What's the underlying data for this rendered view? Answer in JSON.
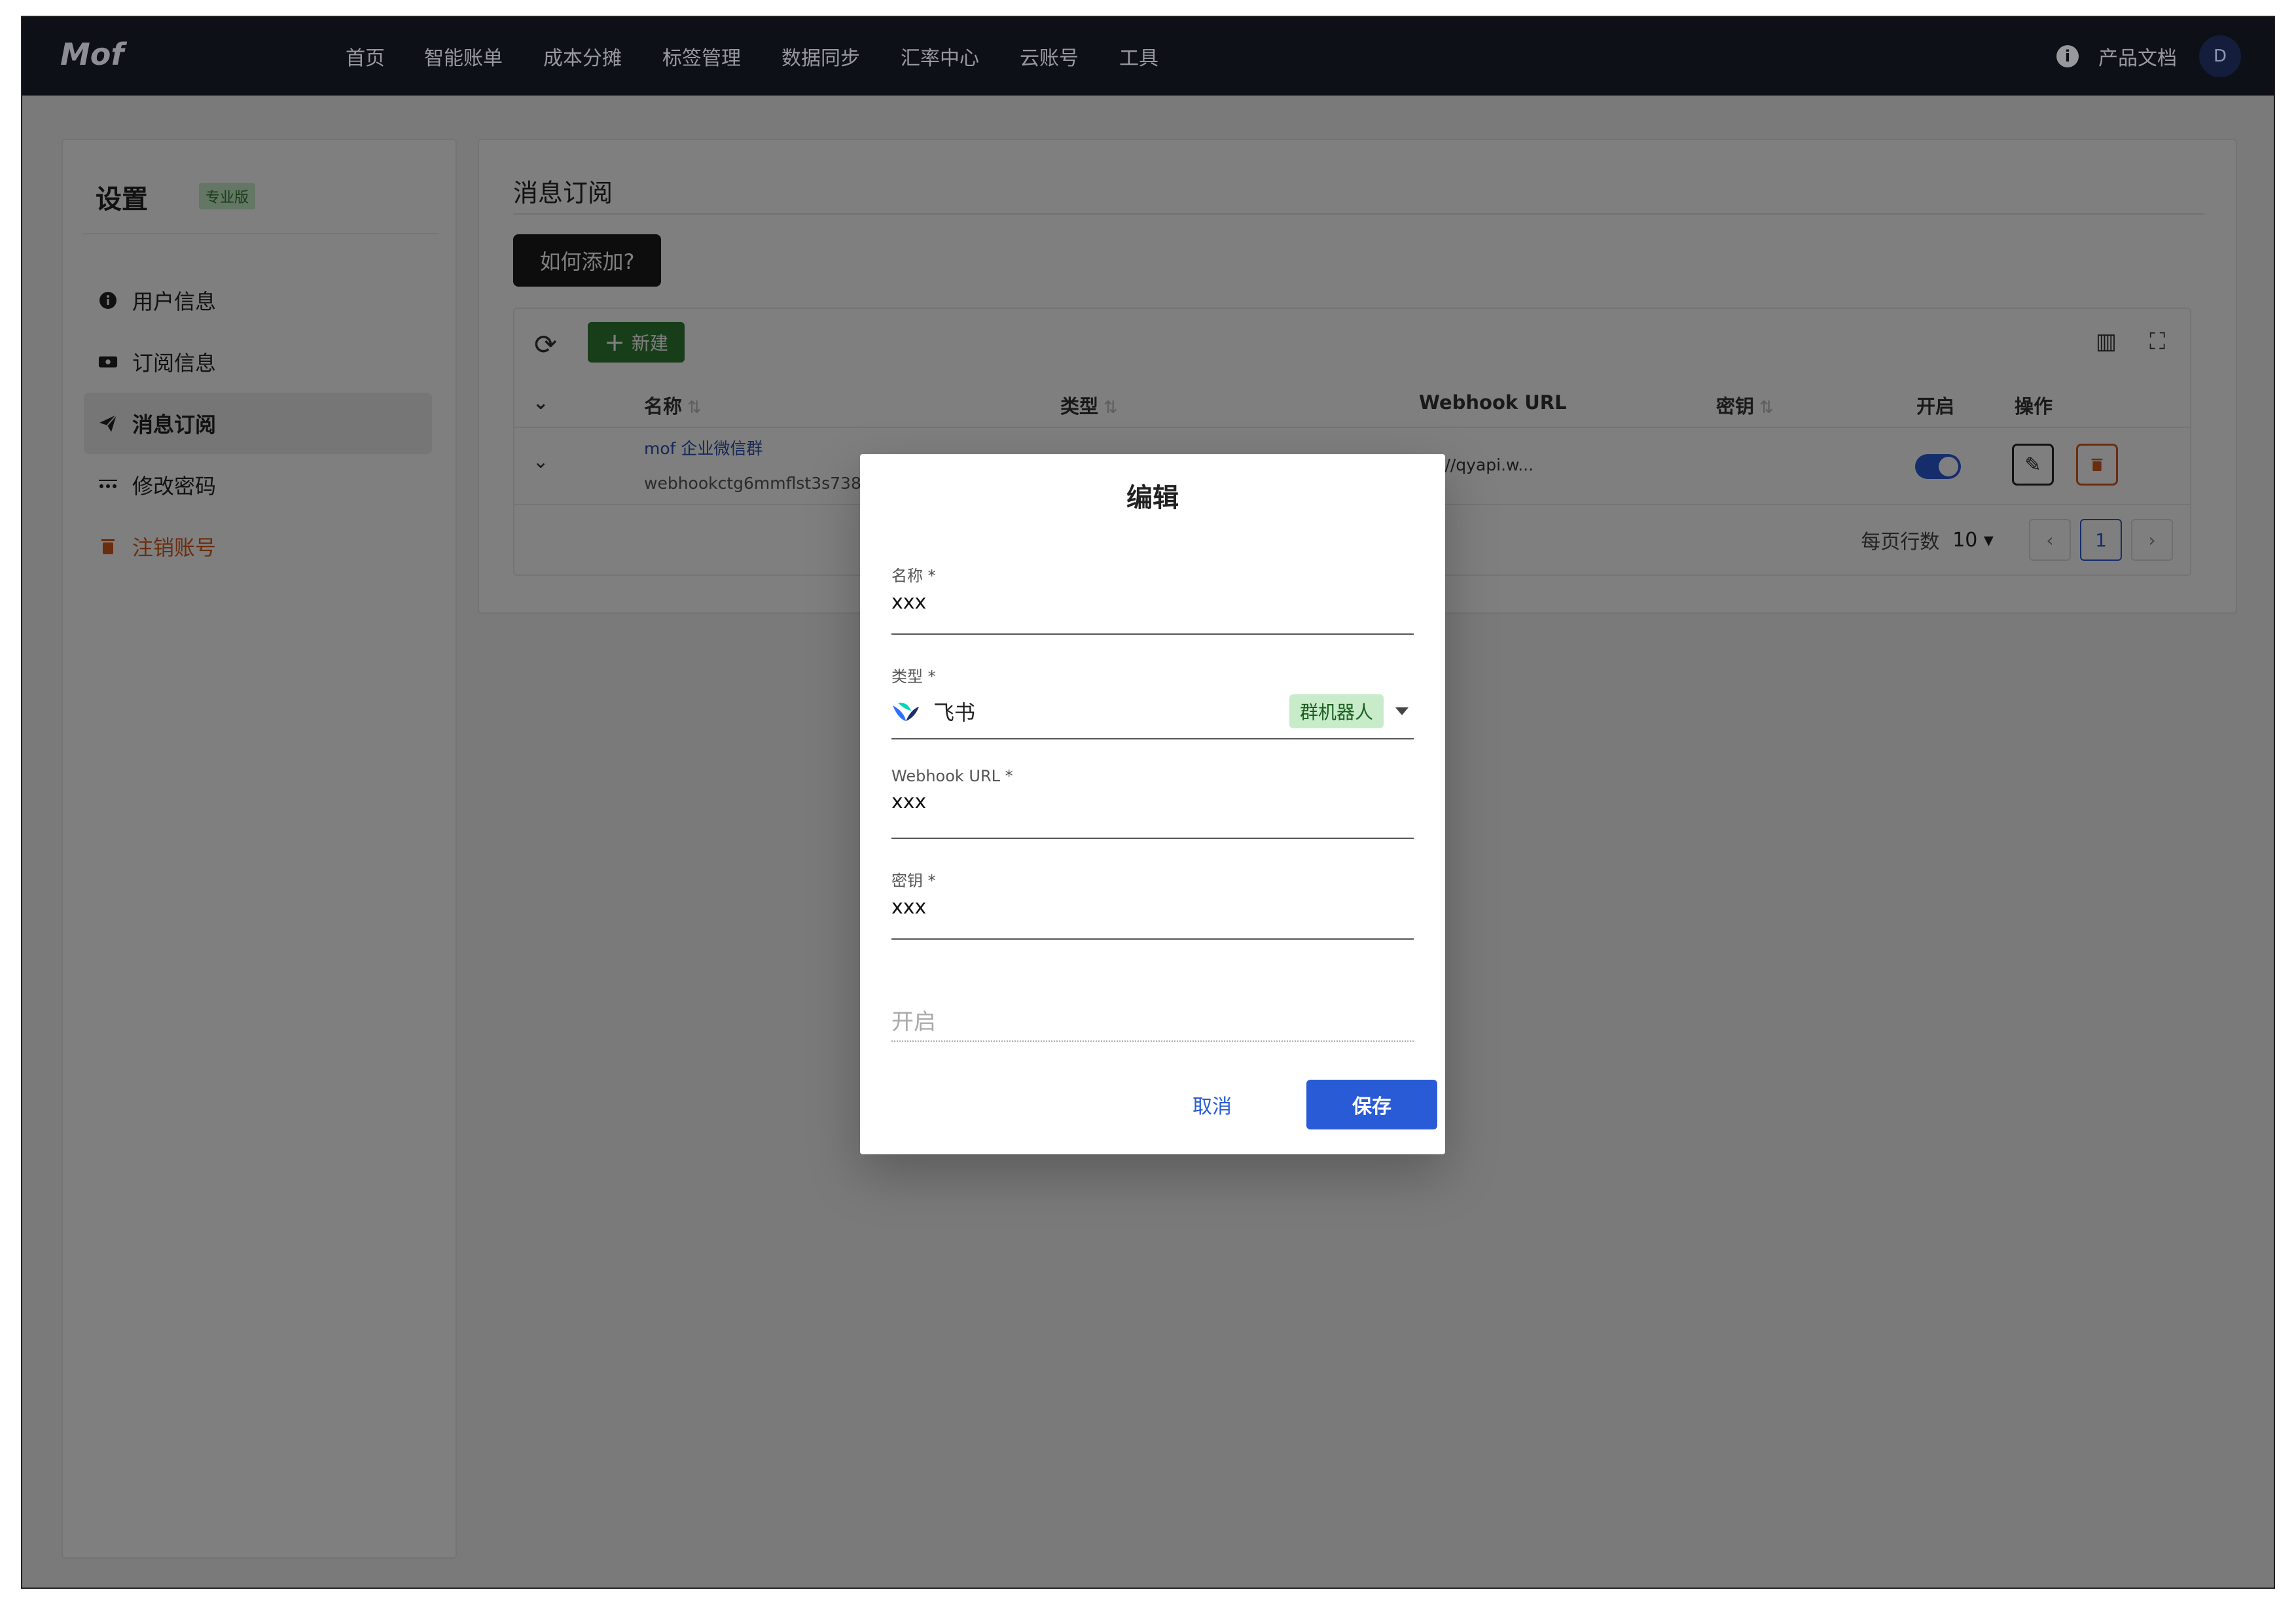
{
  "app": {
    "logo": "Mof"
  },
  "nav": {
    "items": [
      "首页",
      "智能账单",
      "成本分摊",
      "标签管理",
      "数据同步",
      "汇率中心",
      "云账号",
      "工具"
    ]
  },
  "header_right": {
    "docs": "产品文档",
    "avatar": "D"
  },
  "sidebar": {
    "title": "设置",
    "badge": "专业版",
    "items": [
      {
        "label": "用户信息",
        "icon": "info-icon"
      },
      {
        "label": "订阅信息",
        "icon": "ticket-icon"
      },
      {
        "label": "消息订阅",
        "icon": "send-icon",
        "active": true
      },
      {
        "label": "修改密码",
        "icon": "password-icon"
      },
      {
        "label": "注销账号",
        "icon": "trash-icon",
        "danger": true
      }
    ]
  },
  "main": {
    "title": "消息订阅",
    "howto_button": "如何添加?",
    "new_button": "新建",
    "table": {
      "headers": {
        "name": "名称",
        "type": "类型",
        "webhook": "Webhook URL",
        "secret": "密钥",
        "enabled": "开启",
        "actions": "操作"
      },
      "rows": [
        {
          "name": "mof 企业微信群",
          "sub": "webhookctg6mmflst3s738f",
          "url": "s://qyapi.w...",
          "enabled": true
        }
      ]
    },
    "pager": {
      "rows_label": "每页行数",
      "rows_value": "10",
      "current_page": "1"
    }
  },
  "dialog": {
    "title": "编辑",
    "fields": {
      "name": {
        "label": "名称 *",
        "value": "xxx"
      },
      "type": {
        "label": "类型 *",
        "value": "飞书",
        "tag": "群机器人"
      },
      "webhook": {
        "label": "Webhook URL *",
        "value": "xxx"
      },
      "secret": {
        "label": "密钥 *",
        "value": "xxx"
      },
      "enabled": {
        "label": "开启"
      }
    },
    "cancel": "取消",
    "save": "保存"
  },
  "colors": {
    "primary": "#2a5bd7",
    "success": "#2e7d32",
    "danger": "#d65a1e",
    "topbar": "#131722"
  }
}
